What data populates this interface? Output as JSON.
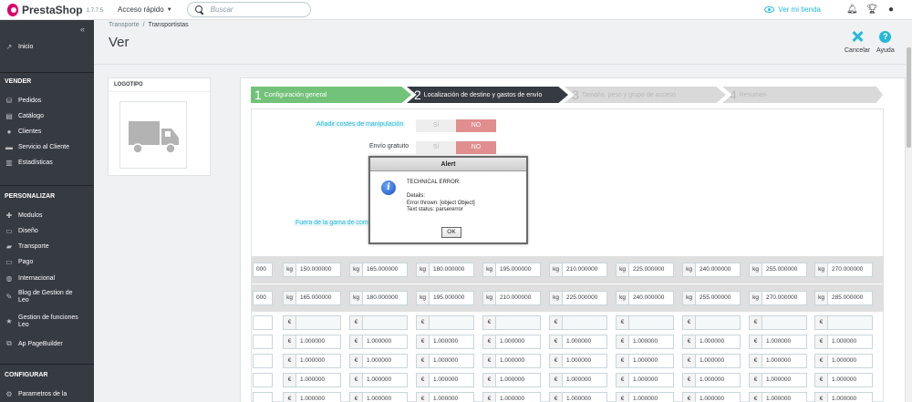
{
  "topbar": {
    "logo_text": "PrestaShop",
    "version": "1.7.7.5",
    "quick_access": "Acceso rápido",
    "search_placeholder": "Buscar",
    "view_store": "Ver mi tienda"
  },
  "sidebar": {
    "collapse_glyph": "«",
    "home": "Inicio",
    "sections": [
      {
        "title": "VENDER",
        "items": [
          "Pedidos",
          "Catálogo",
          "Clientes",
          "Servicio al Cliente",
          "Estadísticas"
        ]
      },
      {
        "title": "PERSONALIZAR",
        "items": [
          "Modulos",
          "Diseño",
          "Transporte",
          "Pago",
          "Internacional",
          "Blog de Gestion de Leo",
          "Gestion de funciones Leo",
          "Ap PageBuilder"
        ]
      },
      {
        "title": "CONFIGURAR",
        "items": [
          "Parametros de la"
        ]
      }
    ]
  },
  "header": {
    "breadcrumb": [
      "Transporte",
      "Transportistas"
    ],
    "breadcrumb_sep": "/",
    "title": "Ver",
    "cancel_label": "Cancelar",
    "help_label": "Ayuda"
  },
  "logo_panel": {
    "title": "LOGOTIPO"
  },
  "wizard": {
    "steps": [
      {
        "num": "1",
        "label": "Configuración general"
      },
      {
        "num": "2",
        "label": "Localización de destino y gastos de envío"
      },
      {
        "num": "3",
        "label": "Tamaño, peso y grupo de acceso"
      },
      {
        "num": "4",
        "label": "Resumen"
      }
    ]
  },
  "form": {
    "handling_label": "Añadir costes de manipulación",
    "free_shipping_label": "Envío gratuito",
    "out_of_range_label": "Fuera de la gama de com",
    "switch_yes": "SÍ",
    "switch_no": "NO"
  },
  "ranges": {
    "unit": "kg",
    "currency": "€",
    "row1_partial": "000",
    "row2_partial": "000",
    "row1": [
      "150.000000",
      "165.000000",
      "180.000000",
      "195.000000",
      "210.000000",
      "225.000000",
      "240.000000",
      "255.000000",
      "270.000000"
    ],
    "row2": [
      "165.000000",
      "180.000000",
      "195.000000",
      "210.000000",
      "225.000000",
      "240.000000",
      "255.000000",
      "270.000000",
      "285.000000"
    ],
    "price_value": "1.000000"
  },
  "alert": {
    "title": "Alert",
    "message": "TECHNICAL ERROR:\n\nDetails:\nError thrown: [object Object]\nText status: parsererror",
    "ok": "OK"
  },
  "colors": {
    "brand": "#df0067",
    "accent": "#25b9d7",
    "step_done": "#72c279",
    "step_active": "#363a41",
    "switch_no": "#e08e8e"
  }
}
